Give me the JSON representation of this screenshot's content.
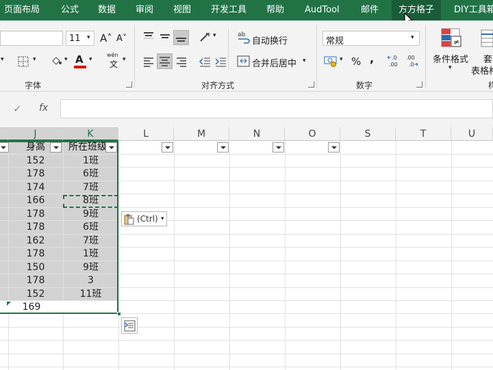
{
  "ribbon_tabs": [
    "页面布局",
    "公式",
    "数据",
    "审阅",
    "视图",
    "开发工具",
    "帮助",
    "AudTool",
    "邮件",
    "方方格子",
    "DIY工具箱"
  ],
  "font_group": {
    "size_value": "11",
    "grow_glyph": "A˄",
    "shrink_glyph": "A˅",
    "font_color_glyph": "A",
    "wen_glyph": "wén",
    "wen_char": "文",
    "label": "字体"
  },
  "align_group": {
    "wrap_label": "自动换行",
    "merge_label": "合并后居中",
    "label": "对齐方式"
  },
  "number_group": {
    "format_value": "常规",
    "percent": "%",
    "comma": ",",
    "inc_decimal": "←.0\n.00",
    "label": "数字"
  },
  "styles_group": {
    "cond_format": "条件格式",
    "table_format_line1": "套",
    "table_format_line2": "表格格",
    "label_fragment": "样"
  },
  "formula_bar": {
    "cancel": "✓",
    "fx": "fx",
    "content": ""
  },
  "columns": [
    "J",
    "K",
    "L",
    "M",
    "N",
    "O",
    "S",
    "T",
    "U"
  ],
  "table": {
    "headers": [
      "身高",
      "所在班级"
    ],
    "rows": [
      [
        "152",
        "1班"
      ],
      [
        "178",
        "6班"
      ],
      [
        "174",
        "7班"
      ],
      [
        "166",
        "8班"
      ],
      [
        "178",
        "9班"
      ],
      [
        "178",
        "6班"
      ],
      [
        "162",
        "7班"
      ],
      [
        "178",
        "1班"
      ],
      [
        "150",
        "9班"
      ],
      [
        "178",
        "3"
      ],
      [
        "152",
        "11班"
      ],
      [
        "169",
        ""
      ]
    ]
  },
  "paste_options": {
    "label": "(Ctrl)"
  },
  "colors": {
    "excel_green": "#217346",
    "selection_gray": "#d2d2d2",
    "font_red": "#e00000"
  }
}
